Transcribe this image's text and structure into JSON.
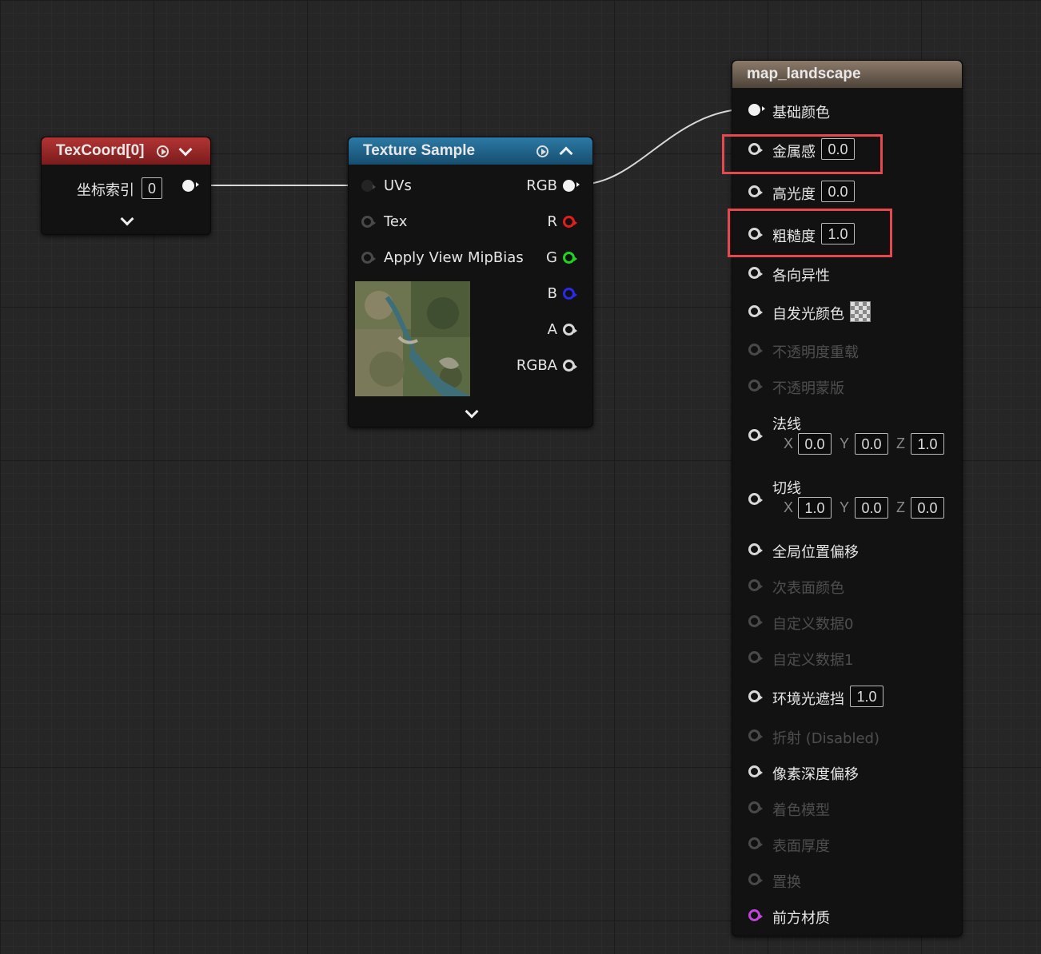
{
  "colors": {
    "tex_header": "#9a2424",
    "sample_header": "#1f5f86",
    "result_header": "#6f6153",
    "highlight": "#e5484d",
    "pin_r": "#e01e1e",
    "pin_g": "#1fd41f",
    "pin_b": "#2a2ae8",
    "pin_front": "#c046d8"
  },
  "texcoord": {
    "title": "TexCoord[0]",
    "index_label": "坐标索引",
    "index_value": "0"
  },
  "sample": {
    "title": "Texture Sample",
    "inputs": [
      "UVs",
      "Tex",
      "Apply View MipBias"
    ],
    "outputs": [
      "RGB",
      "R",
      "G",
      "B",
      "A",
      "RGBA"
    ],
    "thumbnail": "aerial-map-thumbnail"
  },
  "result": {
    "title": "map_landscape",
    "base_color": "基础颜色",
    "metallic": {
      "label": "金属感",
      "value": "0.0"
    },
    "specular": {
      "label": "高光度",
      "value": "0.0"
    },
    "roughness": {
      "label": "粗糙度",
      "value": "1.0"
    },
    "anisotropy": "各向异性",
    "emissive": "自发光颜色",
    "opacity": "不透明度重载",
    "opacity_mask": "不透明蒙版",
    "normal": {
      "label": "法线",
      "x": "0.0",
      "y": "0.0",
      "z": "1.0"
    },
    "tangent": {
      "label": "切线",
      "x": "1.0",
      "y": "0.0",
      "z": "0.0"
    },
    "axis_x": "X",
    "axis_y": "Y",
    "axis_z": "Z",
    "world_offset": "全局位置偏移",
    "subsurface": "次表面颜色",
    "custom0": "自定义数据0",
    "custom1": "自定义数据1",
    "ao": {
      "label": "环境光遮挡",
      "value": "1.0"
    },
    "refraction": "折射 (Disabled)",
    "pixel_depth": "像素深度偏移",
    "shading_model": "着色模型",
    "surface_thickness": "表面厚度",
    "displacement": "置换",
    "front_material": "前方材质"
  }
}
